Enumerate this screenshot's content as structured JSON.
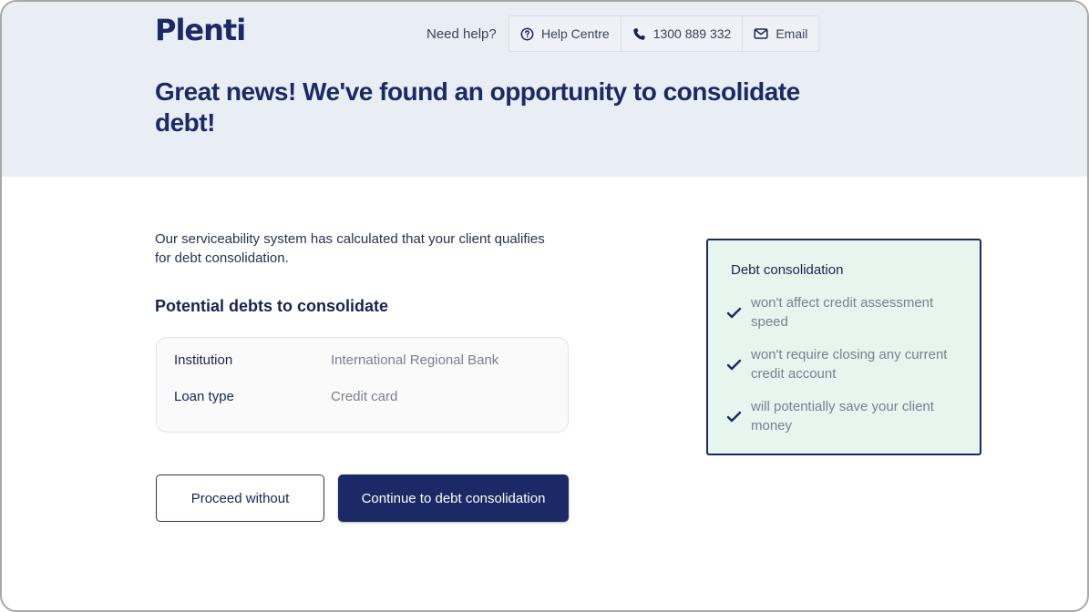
{
  "brand": {
    "logo": "Plenti"
  },
  "help": {
    "label": "Need help?",
    "items": [
      {
        "label": "Help Centre",
        "icon": "question-circle-icon"
      },
      {
        "label": "1300 889 332",
        "icon": "phone-icon"
      },
      {
        "label": "Email",
        "icon": "mail-icon"
      }
    ]
  },
  "hero": {
    "title": "Great news! We've found an opportunity to consolidate debt!"
  },
  "main": {
    "intro": "Our serviceability system has calculated that your client qualifies for debt consolidation.",
    "subheading": "Potential debts to consolidate",
    "debt": {
      "rows": [
        {
          "label": "Institution",
          "value": "International Regional Bank"
        },
        {
          "label": "Loan type",
          "value": "Credit card"
        }
      ]
    },
    "buttons": {
      "proceed_without": "Proceed without",
      "continue": "Continue to debt consolidation"
    }
  },
  "sidebar": {
    "title": "Debt consolidation",
    "benefits": [
      "won't affect credit assessment speed",
      "won't require closing any current credit account",
      "will potentially save your client money"
    ]
  },
  "colors": {
    "brand_navy": "#1b2a66",
    "hero_bg": "#e9eef5",
    "benefit_bg": "#e6f5ee"
  }
}
